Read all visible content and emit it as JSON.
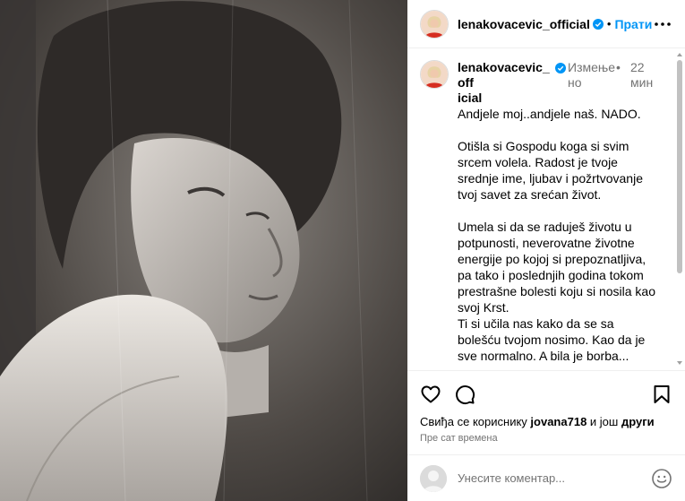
{
  "post": {
    "username": "lenakovacevic_official",
    "follow_label": "Прати",
    "photo_alt": "black and white portrait photo"
  },
  "caption": {
    "username_line1": "lenakovacevic_off",
    "username_line2": "icial",
    "edited_line1": "Измење",
    "edited_line2": "но",
    "dot": "•",
    "time_line1": "22",
    "time_line2": "мин",
    "text": "Andjele moj..andjele naš. NADO.\n\nOtišla si Gospodu koga si svim srcem volela. Radost je tvoje srednje ime, ljubav i požrtvovanje tvoj savet za srećan život.\n\nUmela si da se raduješ životu u potpunosti, neverovatne životne energije po kojoj si prepoznatljiva,\npa tako i poslednjih godina tokom prestrašne bolesti koju si nosila kao svoj Krst.\nTi si učila nas kako da se sa bolešću tvojom nosimo. Kao da je sve normalno. A bila je borba...\n\nBila si i u tome blagodarna.Nasmejana. Zasvijetlila si Svetlost. Mamice..."
  },
  "likes": {
    "prefix": "Свиђа се кориснику ",
    "user": "jovana718",
    "middle": " и још ",
    "suffix": "други"
  },
  "post_time": "Пре сат времена",
  "comment_box": {
    "placeholder": "Унесите коментар..."
  },
  "colors": {
    "accent": "#0095f6",
    "verified": "#0095f6",
    "secondary_text": "#737373",
    "divider": "#efefef"
  },
  "icons": {
    "more": "more-horizontal-icon",
    "like": "heart-outline-icon",
    "comment": "comment-bubble-icon",
    "save": "bookmark-outline-icon",
    "emoji": "smiley-icon"
  }
}
